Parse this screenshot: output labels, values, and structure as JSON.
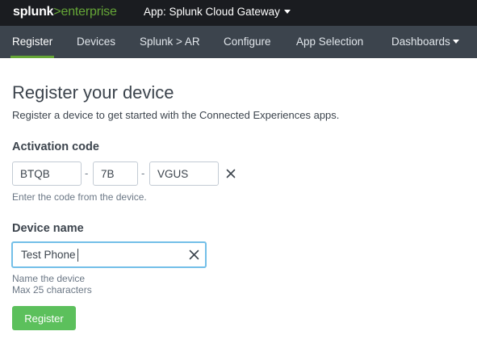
{
  "header": {
    "logo": {
      "brand": "splunk",
      "separator": ">",
      "product": "enterprise"
    },
    "app_menu_label": "App: Splunk Cloud Gateway",
    "app_menu_icon": "caret-down-icon"
  },
  "nav": {
    "items": [
      {
        "label": "Register",
        "active": true
      },
      {
        "label": "Devices"
      },
      {
        "label": "Splunk > AR"
      },
      {
        "label": "Configure"
      },
      {
        "label": "App Selection"
      },
      {
        "label": "Dashboards",
        "icon": "caret-down-icon"
      }
    ]
  },
  "page": {
    "title": "Register your device",
    "subtitle": "Register a device to get started with the Connected Experiences apps."
  },
  "activation": {
    "label": "Activation code",
    "segments": [
      "BTQB",
      "7B",
      "VGUS"
    ],
    "separator": "-",
    "clear_icon": "close-icon",
    "help": "Enter the code from the device."
  },
  "device_name": {
    "label": "Device name",
    "value": "Test Phone",
    "clear_icon": "close-icon",
    "help_line1": "Name the device",
    "help_line2": "Max 25 characters"
  },
  "actions": {
    "register_label": "Register"
  },
  "colors": {
    "topbar": "#1a1c20",
    "navbar": "#3c444d",
    "accent_green": "#65a637",
    "button_green": "#5cc05c",
    "focus_blue": "#73bfe8"
  }
}
